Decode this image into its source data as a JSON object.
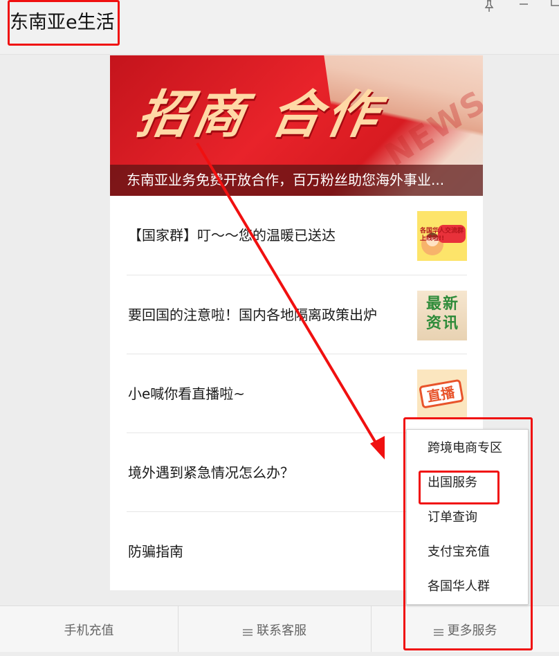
{
  "app": {
    "title": "东南亚e生活",
    "window_controls": {
      "pin_icon": "pin-icon",
      "minimize_icon": "minimize-icon",
      "maximize_icon": "maximize-icon"
    }
  },
  "banner": {
    "headline": "招商 合作",
    "watermark": "NEWS",
    "caption": "东南亚业务免费开放合作，百万粉丝助您海外事业..."
  },
  "articles": [
    {
      "title": "【国家群】叮～～您的温暖已送达",
      "thumb_text": "各国华人交流群 上线啦!!",
      "thumb_icon": "group-chat-thumbnail"
    },
    {
      "title": "要回国的注意啦！国内各地隔离政策出炉",
      "thumb_text": "最新资讯",
      "thumb_icon": "news-thumbnail"
    },
    {
      "title": "小e喊你看直播啦~",
      "thumb_text": "直播",
      "thumb_icon": "live-thumbnail"
    },
    {
      "title": "境外遇到紧急情况怎么办？"
    },
    {
      "title": "防骗指南"
    }
  ],
  "popup_menu": {
    "items": [
      "跨境电商专区",
      "出国服务",
      "订单查询",
      "支付宝充值",
      "各国华人群"
    ]
  },
  "bottom_tabs": [
    {
      "label": "手机充值"
    },
    {
      "label": "联系客服",
      "icon": "menu-icon"
    },
    {
      "label": "更多服务",
      "icon": "menu-icon"
    }
  ],
  "annotation_color": "#f01010"
}
